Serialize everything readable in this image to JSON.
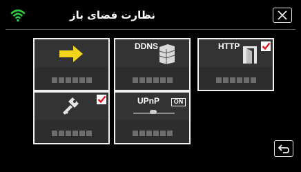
{
  "header": {
    "title": "نظارت فضای باز",
    "wifi_icon": "wifi-signal-icon",
    "wifi_color": "#2ecc40",
    "close_icon": "close-x-icon"
  },
  "tiles": [
    {
      "name": "network-settings",
      "icon": "yellow-arrow-icon",
      "text": "",
      "checked": false
    },
    {
      "name": "ddns",
      "icon": "server-stack-icon",
      "text": "DDNS",
      "checked": false
    },
    {
      "name": "http",
      "icon": "open-door-icon",
      "text": "HTTP",
      "checked": true
    },
    {
      "name": "password",
      "icon": "key-icon",
      "text": "",
      "checked": true
    },
    {
      "name": "upnp",
      "icon": "network-hub-icon",
      "text": "UPnP",
      "badge": "ON",
      "checked": false
    }
  ],
  "footer": {
    "back_icon": "return-arrow-icon"
  },
  "colors": {
    "accent_yellow": "#f2d41c",
    "check_red": "#e0141e",
    "tile_border": "#f2f2f2"
  }
}
